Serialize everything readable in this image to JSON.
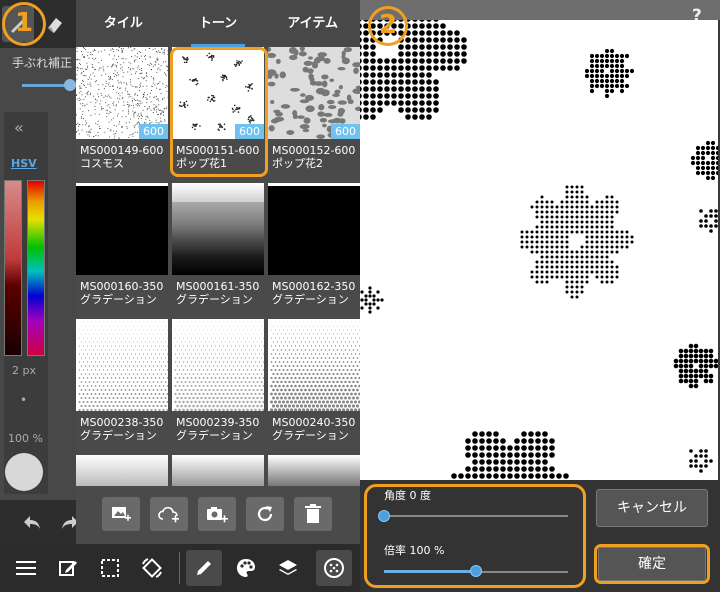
{
  "left_panel": {
    "stabilizer_label": "手ぶれ補正",
    "color_mode": "HSV",
    "brush_size": "2 px",
    "dot": "•",
    "opacity": "100 %"
  },
  "tabs": [
    {
      "label": "タイル"
    },
    {
      "label": "トーン"
    },
    {
      "label": "アイテム"
    }
  ],
  "tones": [
    {
      "line1": "MS000149-600",
      "line2": "コスモス",
      "badge": "600"
    },
    {
      "line1": "MS000151-600",
      "line2": "ポップ花1",
      "badge": "600"
    },
    {
      "line1": "MS000152-600",
      "line2": "ポップ花2",
      "badge": "600"
    },
    {
      "line1": "MS000160-350",
      "line2": "グラデーション",
      "badge": ""
    },
    {
      "line1": "MS000161-350",
      "line2": "グラデーション",
      "badge": ""
    },
    {
      "line1": "MS000162-350",
      "line2": "グラデーション",
      "badge": ""
    },
    {
      "line1": "MS000238-350",
      "line2": "グラデーション",
      "badge": ""
    },
    {
      "line1": "MS000239-350",
      "line2": "グラデーション",
      "badge": ""
    },
    {
      "line1": "MS000240-350",
      "line2": "グラデーション",
      "badge": ""
    }
  ],
  "selected_tone_index": 1,
  "step_markers": [
    "1",
    "2"
  ],
  "help_label": "?",
  "controls": {
    "angle_label": "角度 0 度",
    "scale_label": "倍率 100 %",
    "angle_value": 0,
    "scale_fraction": 0.5
  },
  "buttons": {
    "cancel": "キャンセル",
    "confirm": "確定"
  },
  "colors": {
    "accent": "#4a9fe0",
    "highlight": "#f0a020",
    "badge": "#6ec3ee"
  },
  "icons": {
    "footer": [
      "add-image-icon",
      "cloud-add-icon",
      "camera-add-icon",
      "refresh-icon",
      "delete-icon"
    ],
    "toolbar": [
      "menu-icon",
      "edit-icon",
      "selection-icon",
      "transform-icon",
      "pen-icon",
      "palette-icon",
      "layers-icon",
      "material-icon"
    ]
  }
}
